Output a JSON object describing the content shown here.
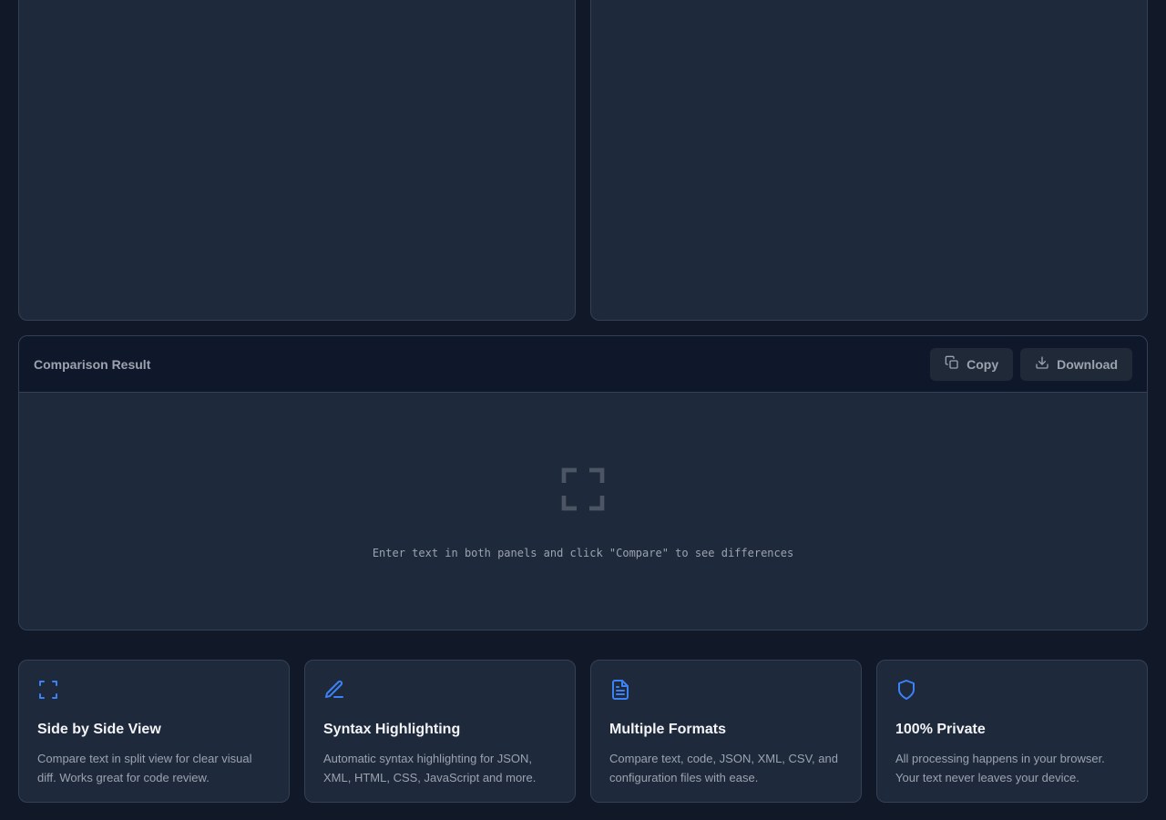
{
  "colors": {
    "background": "#111827",
    "panel": "#1e293b",
    "panel_header": "#0f172a",
    "border": "#334155",
    "accent": "#3b82f6",
    "muted_text": "#9ca3af"
  },
  "editors": {
    "left_value": "",
    "right_value": ""
  },
  "result": {
    "title": "Comparison Result",
    "copy_label": "Copy",
    "copy_icon": "copy-icon",
    "download_label": "Download",
    "download_icon": "download-icon",
    "empty_icon": "expand-icon",
    "empty_text": "Enter text in both panels and click \"Compare\" to see differences"
  },
  "features": [
    {
      "icon": "expand-icon",
      "title": "Side by Side View",
      "description": "Compare text in split view for clear visual diff. Works great for code review."
    },
    {
      "icon": "pencil-icon",
      "title": "Syntax Highlighting",
      "description": "Automatic syntax highlighting for JSON, XML, HTML, CSS, JavaScript and more."
    },
    {
      "icon": "file-text-icon",
      "title": "Multiple Formats",
      "description": "Compare text, code, JSON, XML, CSV, and configuration files with ease."
    },
    {
      "icon": "shield-icon",
      "title": "100% Private",
      "description": "All processing happens in your browser. Your text never leaves your device."
    }
  ]
}
